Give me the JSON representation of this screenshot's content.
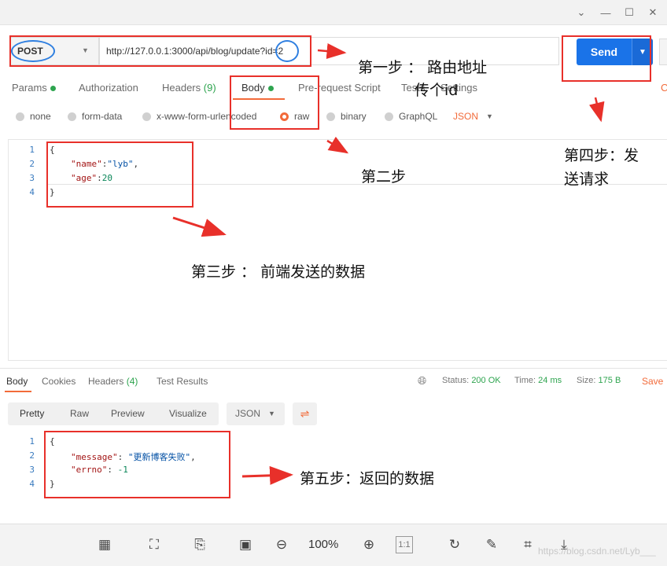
{
  "window": {
    "controls": {
      "collapse": "⌄",
      "minimize": "—",
      "maximize": "☐",
      "close": "✕"
    }
  },
  "request": {
    "method": "POST",
    "url": "http://127.0.0.1:3000/api/blog/update?id=2",
    "send_label": "Send",
    "tabs": [
      {
        "label": "Params",
        "dot": true
      },
      {
        "label": "Authorization"
      },
      {
        "label": "Headers",
        "count": "(9)"
      },
      {
        "label": "Body",
        "dot": true,
        "active": true
      },
      {
        "label": "Pre-request Script"
      },
      {
        "label": "Tests"
      },
      {
        "label": "Settings"
      },
      {
        "label": "C"
      }
    ],
    "body_types": [
      "none",
      "form-data",
      "x-www-form-urlencoded",
      "raw",
      "binary",
      "GraphQL"
    ],
    "body_type_selected": "raw",
    "body_format": "JSON",
    "body_lines": {
      "l1": "{",
      "l2_key": "\"name\"",
      "l2_val": "\"lyb\"",
      "l3_key": "\"age\"",
      "l3_val": "20",
      "l4": "}"
    }
  },
  "response": {
    "tabs": [
      {
        "label": "Body",
        "active": true
      },
      {
        "label": "Cookies"
      },
      {
        "label": "Headers",
        "count": "(4)"
      },
      {
        "label": "Test Results"
      }
    ],
    "status_label": "Status:",
    "status_value": "200 OK",
    "time_label": "Time:",
    "time_value": "24 ms",
    "size_label": "Size:",
    "size_value": "175 B",
    "save_label": "Save",
    "view_modes": [
      "Pretty",
      "Raw",
      "Preview",
      "Visualize"
    ],
    "format": "JSON",
    "body_lines": {
      "l1": "{",
      "l2_key": "\"message\"",
      "l2_val": "\"更新博客失败\"",
      "l3_key": "\"errno\"",
      "l3_val": "-1",
      "l4": "}"
    }
  },
  "annotations": {
    "step1_line1": "第一步 ： 路由地址",
    "step1_line2": "传个id",
    "step2": "第二步",
    "step3": "第三步 ： 前端发送的数据",
    "step4_line1": "第四步：发",
    "step4_line2": "送请求",
    "step5": "第五步：返回的数据"
  },
  "viewer": {
    "zoom": "100%",
    "watermark": "https://blog.csdn.net/Lyb___",
    "icons": [
      "grid-icon",
      "fit-icon",
      "ocr-icon",
      "crop-frame-icon",
      "zoom-out-icon",
      "zoom-in-icon",
      "actual-size-icon",
      "rotate-icon",
      "edit-icon",
      "crop-icon",
      "download-icon"
    ],
    "one_to_one": "1:1"
  },
  "colors": {
    "accent": "#f26b3a",
    "send": "#1a73e8",
    "annotation_box": "#e8302a",
    "annotation_ellipse": "#2f7fe0",
    "status_ok": "#2ea44f"
  }
}
